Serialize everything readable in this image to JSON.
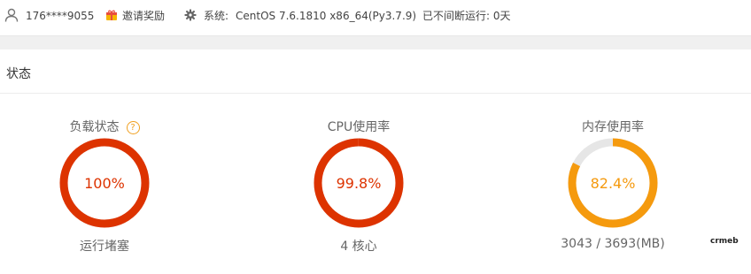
{
  "topbar": {
    "user": "176****9055",
    "invite_label": "邀请奖励",
    "system_label": "系统:",
    "system_value": "CentOS 7.6.1810 x86_64(Py3.7.9)",
    "uptime": "已不间断运行: 0天"
  },
  "section": {
    "title": "状态"
  },
  "gauges": [
    {
      "title": "负载状态",
      "value_text": "100%",
      "fraction": 1.0,
      "sub": "运行堵塞",
      "color": "#dd3300",
      "help_icon": "question-circle-icon"
    },
    {
      "title": "CPU使用率",
      "value_text": "99.8%",
      "fraction": 0.998,
      "sub": "4 核心",
      "color": "#dd3300"
    },
    {
      "title": "内存使用率",
      "value_text": "82.4%",
      "fraction": 0.824,
      "sub": "3043 / 3693(MB)",
      "color": "#f59a0e"
    }
  ],
  "colors": {
    "track": "#e6e6e6",
    "accent_green": "#20a53a"
  },
  "watermark": "crmeb",
  "icons": [
    "user-icon",
    "gift-icon",
    "gear-icon",
    "question-circle-icon"
  ]
}
